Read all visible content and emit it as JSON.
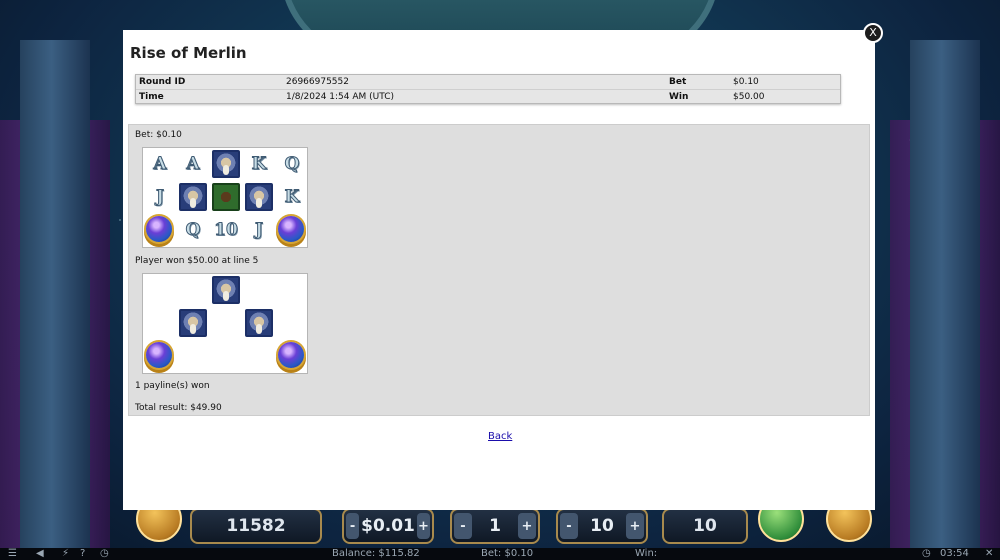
{
  "modal": {
    "title": "Rise of Merlin",
    "close_label": "X",
    "info_rows": [
      {
        "label1": "Round ID",
        "value1": "26966975552",
        "label2": "Bet",
        "value2": "$0.10"
      },
      {
        "label1": "Time",
        "value1": "1/8/2024 1:54 AM (UTC)",
        "label2": "Win",
        "value2": "$50.00"
      }
    ],
    "bet_text": "Bet: $0.10",
    "reel_grid": [
      [
        "A",
        "A",
        "merlin",
        "K",
        "Q"
      ],
      [
        "J",
        "merlin",
        "book",
        "merlin",
        "K"
      ],
      [
        "orb",
        "Q",
        "10",
        "J",
        "orb"
      ]
    ],
    "win_text": "Player won $50.00 at line 5",
    "win_grid": [
      [
        "",
        "",
        "merlin",
        "",
        ""
      ],
      [
        "",
        "merlin",
        "",
        "merlin",
        ""
      ],
      [
        "orb",
        "",
        "",
        "",
        "orb"
      ]
    ],
    "paylines_text": "1 payline(s) won",
    "total_text": "Total result: $49.90",
    "back_label": "Back"
  },
  "hud": {
    "credits": "11582",
    "coin_value": "$0.01",
    "level": "1",
    "lines": "10",
    "total": "10",
    "minus": "-",
    "plus": "+"
  },
  "statusbar": {
    "balance": "Balance: $115.82",
    "bet": "Bet: $0.10",
    "win": "Win:",
    "clock": "03:54"
  },
  "colors": {
    "modal_bg": "#ffffff",
    "panel_bg": "#dedede",
    "link": "#1a0dab",
    "hud_border": "#a88a4d"
  }
}
